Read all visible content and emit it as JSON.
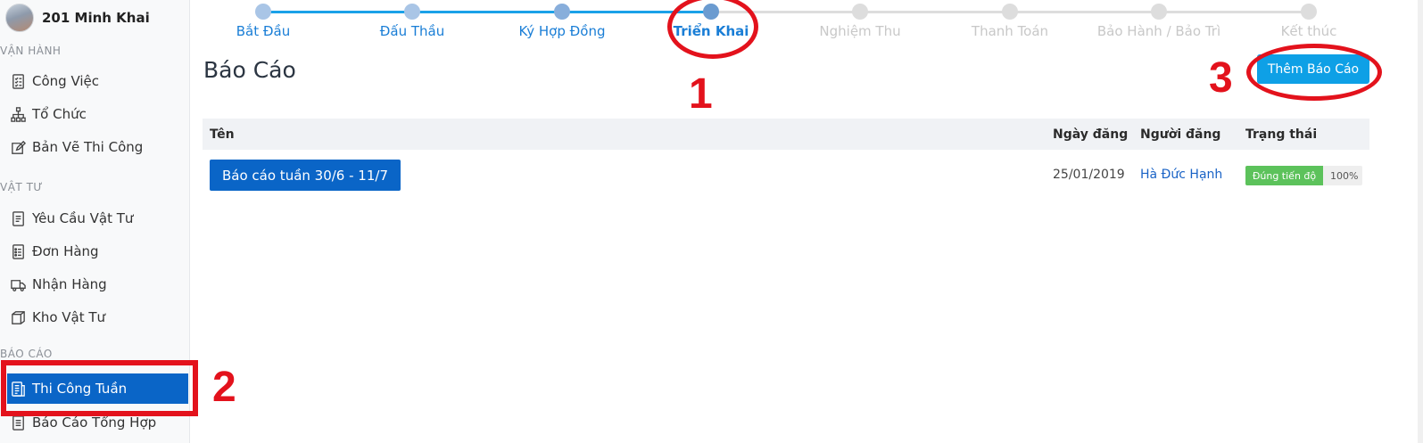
{
  "sidebar": {
    "project_name": "201 Minh Khai",
    "sections": [
      {
        "title": "VẬN HÀNH"
      },
      {
        "title": "VẬT TƯ"
      },
      {
        "title": "BÁO CÁO"
      }
    ],
    "items": [
      {
        "label": "Công Việc",
        "icon": "checklist-icon"
      },
      {
        "label": "Tổ Chức",
        "icon": "org-chart-icon"
      },
      {
        "label": "Bản Vẽ Thi Công",
        "icon": "drawing-icon"
      },
      {
        "label": "Yêu Cầu Vật Tư",
        "icon": "document-icon"
      },
      {
        "label": "Đơn Hàng",
        "icon": "order-list-icon"
      },
      {
        "label": "Nhận Hàng",
        "icon": "truck-icon"
      },
      {
        "label": "Kho Vật Tư",
        "icon": "box-icon"
      },
      {
        "label": "Thi Công Tuần",
        "icon": "report-icon",
        "active": true
      },
      {
        "label": "Báo Cáo Tổng Hợp",
        "icon": "summary-icon"
      }
    ]
  },
  "stepper": {
    "steps": [
      {
        "label": "Bắt Đầu",
        "state": "done"
      },
      {
        "label": "Đấu Thầu",
        "state": "done"
      },
      {
        "label": "Ký Hợp Đồng",
        "state": "done"
      },
      {
        "label": "Triển Khai",
        "state": "current"
      },
      {
        "label": "Nghiệm Thu",
        "state": "pending"
      },
      {
        "label": "Thanh Toán",
        "state": "pending"
      },
      {
        "label": "Bảo Hành / Bảo Trì",
        "state": "pending"
      },
      {
        "label": "Kết thúc",
        "state": "pending"
      }
    ],
    "colors": {
      "done_dot": "#a9c5e6",
      "done_line": "#1aa1e8",
      "current_dot": "#6b9bd0",
      "pending": "#dddddd",
      "done_text": "#1a7ed6",
      "pending_text": "#c8c8c8",
      "current_text": "#1a7ed6"
    }
  },
  "main": {
    "title": "Báo Cáo",
    "add_button": "Thêm Báo Cáo",
    "table": {
      "headers": {
        "name": "Tên",
        "date": "Ngày đăng",
        "user": "Người đăng",
        "status": "Trạng thái"
      },
      "rows": [
        {
          "name": "Báo cáo tuần 30/6 - 11/7",
          "date": "25/01/2019",
          "user": "Hà Đức Hạnh",
          "status": "Đúng tiến độ",
          "progress_pct": "100%",
          "progress": 1.0
        }
      ]
    }
  },
  "annotations": {
    "one": "1",
    "two": "2",
    "three": "3"
  }
}
